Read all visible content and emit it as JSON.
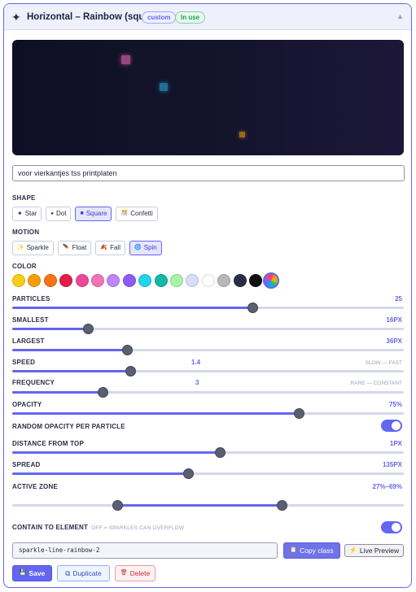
{
  "header": {
    "title": "Horizontal – Rainbow (squares)",
    "icon": "sparkle-icon",
    "badge_custom": "custom",
    "badge_in_use": "In use",
    "collapse_icon": "chevron-up-icon",
    "collapse_glyph": "▲"
  },
  "description": {
    "value": "voor vierkantjes tss printplaten"
  },
  "shape": {
    "label": "SHAPE",
    "options": [
      {
        "glyph": "✦",
        "label": "Star",
        "active": false
      },
      {
        "glyph": "●",
        "label": "Dot",
        "active": false
      },
      {
        "glyph": "■",
        "label": "Square",
        "active": true
      },
      {
        "glyph": "🎊",
        "label": "Confetti",
        "active": false
      }
    ]
  },
  "motion": {
    "label": "MOTION",
    "options": [
      {
        "glyph": "✨",
        "label": "Sparkle",
        "active": false
      },
      {
        "glyph": "🪶",
        "label": "Float",
        "active": false
      },
      {
        "glyph": "🍂",
        "label": "Fall",
        "active": false
      },
      {
        "glyph": "🌀",
        "label": "Spin",
        "active": true
      }
    ]
  },
  "color": {
    "label": "COLOR",
    "swatches": [
      "#facc15",
      "#f59e0b",
      "#f97316",
      "#e11d48",
      "#ec4899",
      "#f472b6",
      "#c084fc",
      "#8b5cf6",
      "#22d3ee",
      "#14b8a6",
      "#a7f3a7",
      "#d6defa",
      "#ffffff",
      "#b8b8b8",
      "#2a2d45",
      "#111111"
    ],
    "selected": "rainbow"
  },
  "sliders": {
    "particles": {
      "label": "PARTICLES",
      "value_text": "25",
      "fraction": 0.614
    },
    "smallest": {
      "label": "SMALLEST",
      "value_text": "16PX",
      "fraction": 0.195
    },
    "largest": {
      "label": "LARGEST",
      "value_text": "36PX",
      "fraction": 0.295
    },
    "speed": {
      "label": "SPEED",
      "value_text": "1.4",
      "hint": "SLOW — FAST",
      "fraction": 0.302
    },
    "frequency": {
      "label": "FREQUENCY",
      "value_text": "3",
      "hint": "RARE — CONSTANT",
      "fraction": 0.232
    },
    "opacity": {
      "label": "OPACITY",
      "value_text": "75%",
      "fraction": 0.733
    },
    "distance_from_top": {
      "label": "DISTANCE FROM TOP",
      "value_text": "1PX",
      "fraction": 0.532
    },
    "spread": {
      "label": "SPREAD",
      "value_text": "135PX",
      "fraction": 0.451
    },
    "active_zone": {
      "label": "ACTIVE ZONE",
      "value_text": "27%–69%",
      "start": 0.27,
      "end": 0.69
    }
  },
  "toggles": {
    "random_opacity": {
      "label": "RANDOM OPACITY PER PARTICLE",
      "on": true
    },
    "contain": {
      "label": "CONTAIN TO ELEMENT",
      "hint": "OFF = SPARKLES CAN OVERFLOW",
      "on": true
    }
  },
  "class_name": "sparkle-line-rainbow-2",
  "buttons": {
    "copy_class": "Copy class",
    "copy_glyph": "📋",
    "live_preview": "Live Preview",
    "live_glyph": "⚡",
    "save": "Save",
    "save_glyph": "💾",
    "duplicate": "Duplicate",
    "duplicate_glyph": "⧉",
    "delete": "Delete",
    "delete_glyph": "🗑"
  }
}
